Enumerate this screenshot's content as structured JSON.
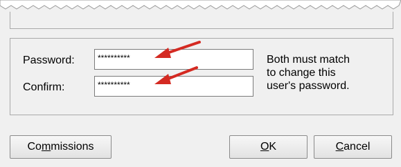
{
  "form": {
    "password_label": "Password:",
    "password_value": "**********",
    "confirm_label": "Confirm:",
    "confirm_value": "**********",
    "help_line1": "Both must match",
    "help_line2": "to change this",
    "help_line3": "user's password."
  },
  "buttons": {
    "commissions": {
      "pre": "Co",
      "mnemonic": "m",
      "post": "missions"
    },
    "ok": {
      "pre": "",
      "mnemonic": "O",
      "post": "K"
    },
    "cancel": {
      "pre": "",
      "mnemonic": "C",
      "post": "ancel"
    }
  },
  "colors": {
    "annotation_arrow": "#d42a22",
    "dialog_background": "#f0f0f0"
  }
}
